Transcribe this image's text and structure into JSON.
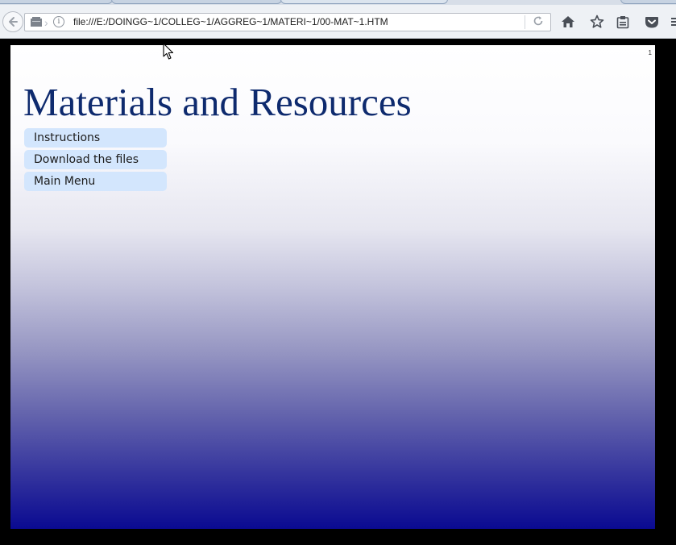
{
  "browser": {
    "url": "file:///E:/DOINGG~1/COLLEG~1/AGGREG~1/MATERI~1/00-MAT~1.HTM",
    "icons": {
      "back": "back-arrow-icon",
      "page": "page-icon",
      "info": "info-icon",
      "reload": "reload-icon",
      "home": "home-icon",
      "bookmark": "star-icon",
      "reading_list": "clipboard-icon",
      "pocket": "pocket-icon"
    }
  },
  "slide": {
    "number": "1",
    "title": "Materials and Resources",
    "menu": [
      {
        "label": "Instructions"
      },
      {
        "label": "Download the files"
      },
      {
        "label": "Main Menu"
      }
    ]
  },
  "colors": {
    "title": "#0e2a6e",
    "menu_bg": "#d3e6fd",
    "gradient_top": "#ffffff",
    "gradient_bottom": "#0a0a91"
  }
}
